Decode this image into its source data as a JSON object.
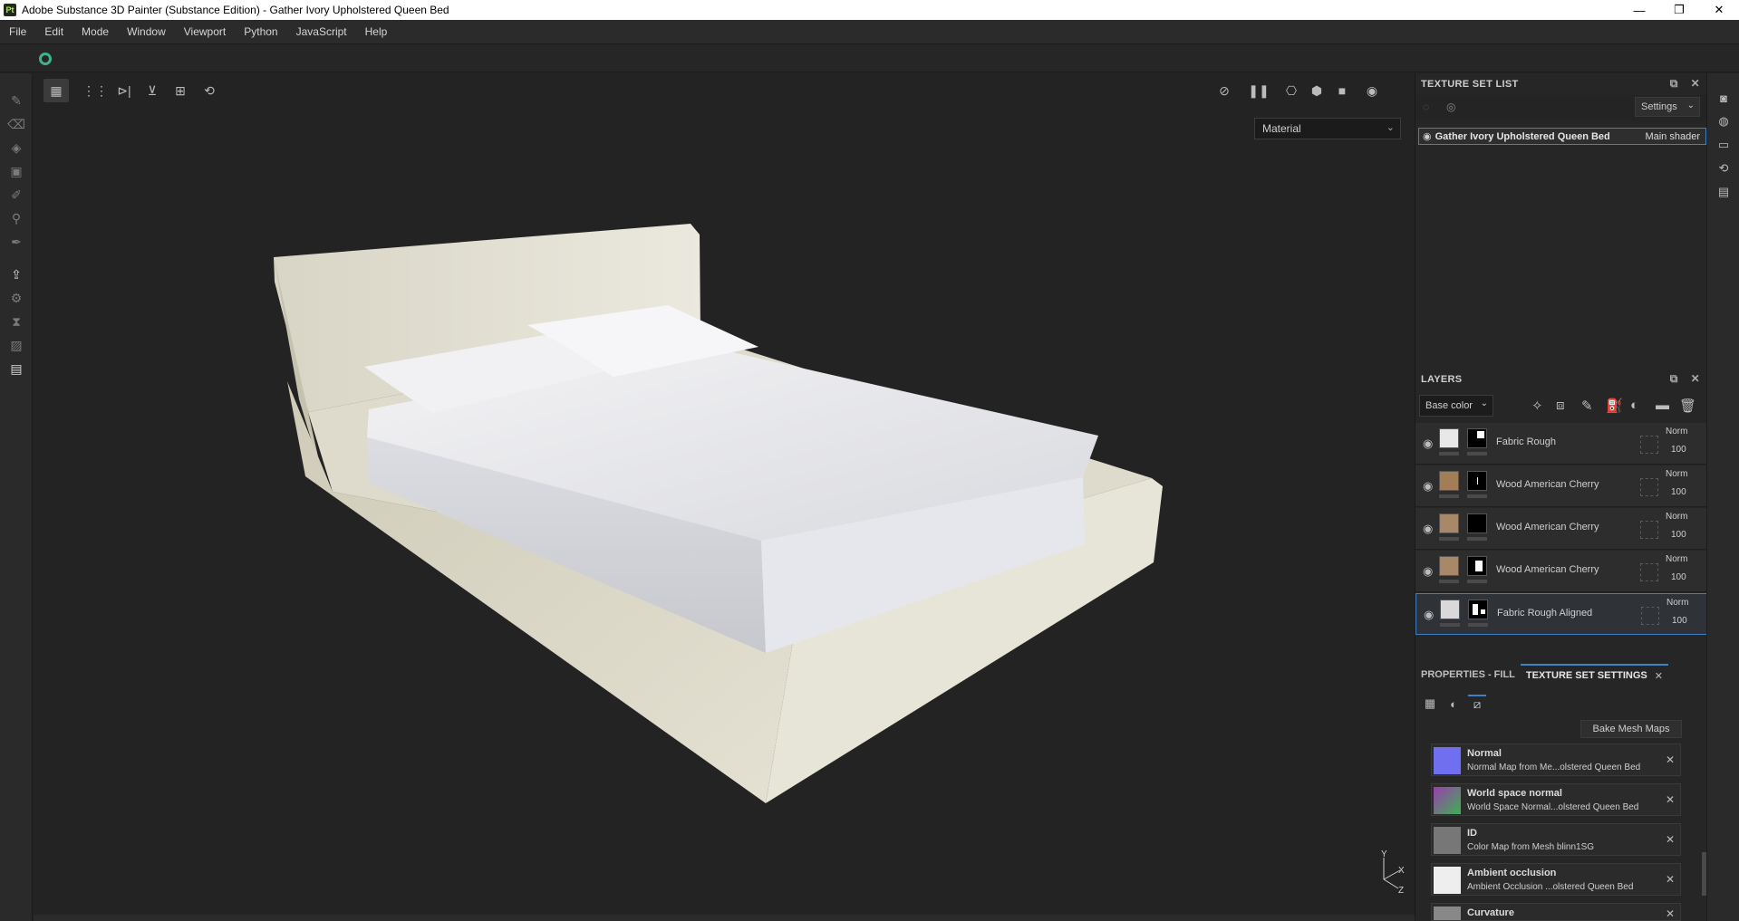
{
  "window": {
    "app_badge": "Pt",
    "title": "Adobe Substance 3D Painter (Substance Edition) - Gather Ivory Upholstered Queen Bed",
    "minimize": "—",
    "maximize": "❐",
    "close": "✕"
  },
  "menu": [
    "File",
    "Edit",
    "Mode",
    "Window",
    "Viewport",
    "Python",
    "JavaScript",
    "Help"
  ],
  "viewport": {
    "material_mode": "Material",
    "axis_x": "X",
    "axis_y": "Y",
    "axis_z": "Z"
  },
  "texture_set_list": {
    "header": "TEXTURE SET LIST",
    "settings_label": "Settings",
    "item_name": "Gather Ivory Upholstered Queen Bed",
    "item_shader": "Main shader"
  },
  "layers": {
    "header": "LAYERS",
    "channel": "Base color",
    "items": [
      {
        "name": "Fabric Rough",
        "blend": "Norm",
        "opacity": "100",
        "thumb_color": "#e8e8e8"
      },
      {
        "name": "Wood American Cherry",
        "blend": "Norm",
        "opacity": "100",
        "thumb_color": "#a27d58"
      },
      {
        "name": "Wood American Cherry",
        "blend": "Norm",
        "opacity": "100",
        "thumb_color": "#a98769"
      },
      {
        "name": "Wood American Cherry",
        "blend": "Norm",
        "opacity": "100",
        "thumb_color": "#a98769"
      },
      {
        "name": "Fabric Rough Aligned",
        "blend": "Norm",
        "opacity": "100",
        "thumb_color": "#d9d9d9"
      }
    ]
  },
  "properties": {
    "tab_fill": "PROPERTIES - FILL",
    "tab_tss": "TEXTURE SET SETTINGS",
    "bake_label": "Bake Mesh Maps",
    "maps": [
      {
        "title": "Normal",
        "sub": "Normal Map from Me...olstered Queen Bed",
        "icon_color": "#6f6ff0"
      },
      {
        "title": "World space normal",
        "sub": "World Space Normal...olstered Queen Bed",
        "icon_color": "#9a3fb0"
      },
      {
        "title": "ID",
        "sub": "Color Map from Mesh blinn1SG",
        "icon_color": "#777777"
      },
      {
        "title": "Ambient occlusion",
        "sub": "Ambient Occlusion ...olstered Queen Bed",
        "icon_color": "#eeeeee"
      },
      {
        "title": "Curvature",
        "sub": "",
        "icon_color": "#888888"
      }
    ]
  },
  "colors": {
    "accent": "#3d80c6",
    "logo": "#3db38a"
  }
}
